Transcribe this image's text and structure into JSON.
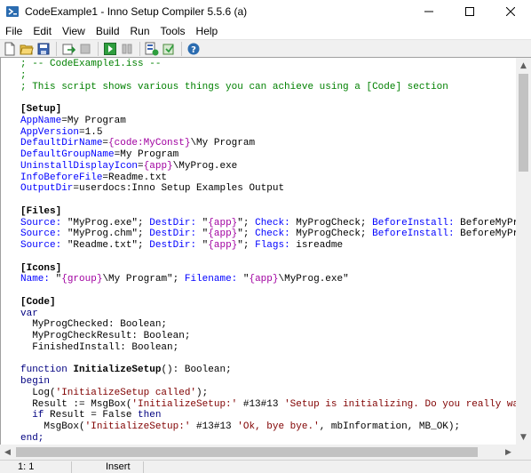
{
  "window": {
    "title": "CodeExample1 - Inno Setup Compiler 5.5.6 (a)",
    "minimize_glyph": "─",
    "maximize_glyph": "☐",
    "close_glyph": "✕"
  },
  "menu": [
    "File",
    "Edit",
    "View",
    "Build",
    "Run",
    "Tools",
    "Help"
  ],
  "toolbar": {
    "buttons": [
      "new-file-icon",
      "open-file-icon",
      "save-icon",
      "compile-icon",
      "stop-compile-icon",
      "run-icon",
      "pause-icon",
      "target-setup-icon",
      "target-uninstall-icon",
      "help-icon"
    ]
  },
  "editor": {
    "lines": [
      [
        {
          "t": "; -- CodeExample1.iss --",
          "c": "cm"
        }
      ],
      [
        {
          "t": ";",
          "c": "cm"
        }
      ],
      [
        {
          "t": "; This script shows various things you can achieve using a [Code] section",
          "c": "cm"
        }
      ],
      [
        {
          "t": "",
          "c": ""
        }
      ],
      [
        {
          "t": "[Setup]",
          "c": "sec"
        }
      ],
      [
        {
          "t": "AppName",
          "c": "key"
        },
        {
          "t": "=My Program",
          "c": ""
        }
      ],
      [
        {
          "t": "AppVersion",
          "c": "key"
        },
        {
          "t": "=1.5",
          "c": ""
        }
      ],
      [
        {
          "t": "DefaultDirName",
          "c": "key"
        },
        {
          "t": "=",
          "c": ""
        },
        {
          "t": "{code:MyConst}",
          "c": "cst"
        },
        {
          "t": "\\My Program",
          "c": ""
        }
      ],
      [
        {
          "t": "DefaultGroupName",
          "c": "key"
        },
        {
          "t": "=My Program",
          "c": ""
        }
      ],
      [
        {
          "t": "UninstallDisplayIcon",
          "c": "key"
        },
        {
          "t": "=",
          "c": ""
        },
        {
          "t": "{app}",
          "c": "cst"
        },
        {
          "t": "\\MyProg.exe",
          "c": ""
        }
      ],
      [
        {
          "t": "InfoBeforeFile",
          "c": "key"
        },
        {
          "t": "=Readme.txt",
          "c": ""
        }
      ],
      [
        {
          "t": "OutputDir",
          "c": "key"
        },
        {
          "t": "=userdocs:Inno Setup Examples Output",
          "c": ""
        }
      ],
      [
        {
          "t": "",
          "c": ""
        }
      ],
      [
        {
          "t": "[Files]",
          "c": "sec"
        }
      ],
      [
        {
          "t": "Source:",
          "c": "prm"
        },
        {
          "t": " \"MyProg.exe\"; ",
          "c": ""
        },
        {
          "t": "DestDir:",
          "c": "prm"
        },
        {
          "t": " \"",
          "c": ""
        },
        {
          "t": "{app}",
          "c": "cst"
        },
        {
          "t": "\"; ",
          "c": ""
        },
        {
          "t": "Check:",
          "c": "prm"
        },
        {
          "t": " MyProgCheck; ",
          "c": ""
        },
        {
          "t": "BeforeInstall:",
          "c": "prm"
        },
        {
          "t": " BeforeMyProgI",
          "c": ""
        }
      ],
      [
        {
          "t": "Source:",
          "c": "prm"
        },
        {
          "t": " \"MyProg.chm\"; ",
          "c": ""
        },
        {
          "t": "DestDir:",
          "c": "prm"
        },
        {
          "t": " \"",
          "c": ""
        },
        {
          "t": "{app}",
          "c": "cst"
        },
        {
          "t": "\"; ",
          "c": ""
        },
        {
          "t": "Check:",
          "c": "prm"
        },
        {
          "t": " MyProgCheck; ",
          "c": ""
        },
        {
          "t": "BeforeInstall:",
          "c": "prm"
        },
        {
          "t": " BeforeMyProgI",
          "c": ""
        }
      ],
      [
        {
          "t": "Source:",
          "c": "prm"
        },
        {
          "t": " \"Readme.txt\"; ",
          "c": ""
        },
        {
          "t": "DestDir:",
          "c": "prm"
        },
        {
          "t": " \"",
          "c": ""
        },
        {
          "t": "{app}",
          "c": "cst"
        },
        {
          "t": "\"; ",
          "c": ""
        },
        {
          "t": "Flags:",
          "c": "prm"
        },
        {
          "t": " isreadme",
          "c": ""
        }
      ],
      [
        {
          "t": "",
          "c": ""
        }
      ],
      [
        {
          "t": "[Icons]",
          "c": "sec"
        }
      ],
      [
        {
          "t": "Name:",
          "c": "prm"
        },
        {
          "t": " \"",
          "c": ""
        },
        {
          "t": "{group}",
          "c": "cst"
        },
        {
          "t": "\\My Program\"; ",
          "c": ""
        },
        {
          "t": "Filename:",
          "c": "prm"
        },
        {
          "t": " \"",
          "c": ""
        },
        {
          "t": "{app}",
          "c": "cst"
        },
        {
          "t": "\\MyProg.exe\"",
          "c": ""
        }
      ],
      [
        {
          "t": "",
          "c": ""
        }
      ],
      [
        {
          "t": "[Code]",
          "c": "sec"
        }
      ],
      [
        {
          "t": "var",
          "c": "kw"
        }
      ],
      [
        {
          "t": "  MyProgChecked: Boolean;",
          "c": ""
        }
      ],
      [
        {
          "t": "  MyProgCheckResult: Boolean;",
          "c": ""
        }
      ],
      [
        {
          "t": "  FinishedInstall: Boolean;",
          "c": ""
        }
      ],
      [
        {
          "t": "",
          "c": ""
        }
      ],
      [
        {
          "t": "function",
          "c": "kw"
        },
        {
          "t": " ",
          "c": ""
        },
        {
          "t": "InitializeSetup",
          "c": "fnb"
        },
        {
          "t": "(): Boolean;",
          "c": ""
        }
      ],
      [
        {
          "t": "begin",
          "c": "kw"
        }
      ],
      [
        {
          "t": "  Log(",
          "c": ""
        },
        {
          "t": "'InitializeSetup called'",
          "c": "str"
        },
        {
          "t": ");",
          "c": ""
        }
      ],
      [
        {
          "t": "  Result := MsgBox(",
          "c": ""
        },
        {
          "t": "'InitializeSetup:'",
          "c": "str"
        },
        {
          "t": " #13#13 ",
          "c": ""
        },
        {
          "t": "'Setup is initializing. Do you really want",
          "c": "str"
        }
      ],
      [
        {
          "t": "  ",
          "c": ""
        },
        {
          "t": "if",
          "c": "kw"
        },
        {
          "t": " Result = False ",
          "c": ""
        },
        {
          "t": "then",
          "c": "kw"
        }
      ],
      [
        {
          "t": "    MsgBox(",
          "c": ""
        },
        {
          "t": "'InitializeSetup:'",
          "c": "str"
        },
        {
          "t": " #13#13 ",
          "c": ""
        },
        {
          "t": "'Ok, bye bye.'",
          "c": "str"
        },
        {
          "t": ", mbInformation, MB_OK);",
          "c": ""
        }
      ],
      [
        {
          "t": "end;",
          "c": "kw"
        }
      ]
    ]
  },
  "scrollbars": {
    "up_arrow": "▲",
    "down_arrow": "▼",
    "left_arrow": "◀",
    "right_arrow": "▶"
  },
  "status": {
    "position": "1:   1",
    "mode": "Insert"
  }
}
